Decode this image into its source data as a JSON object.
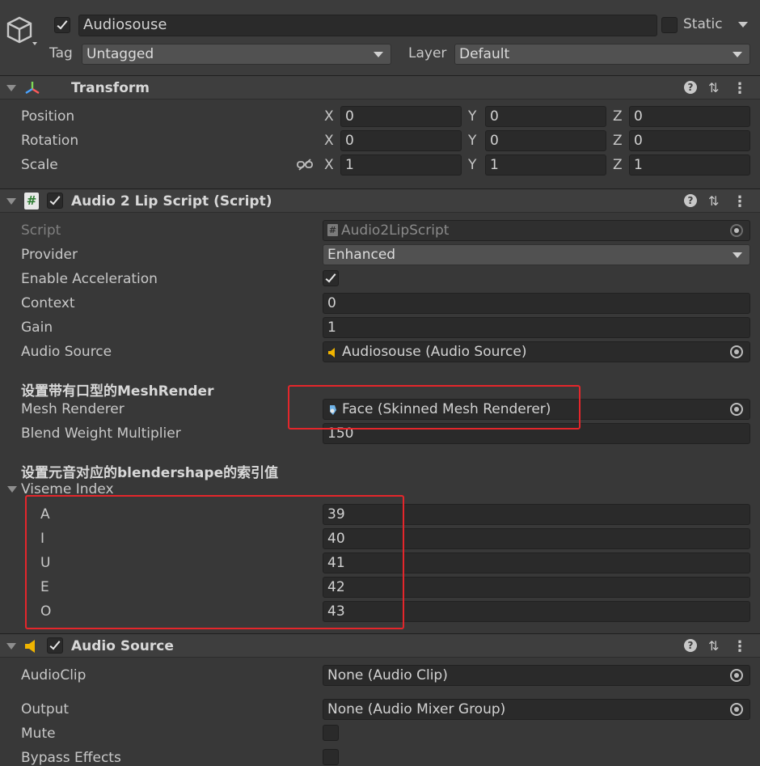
{
  "header": {
    "object_name": "Audiosouse",
    "static_label": "Static",
    "tag_label": "Tag",
    "tag_value": "Untagged",
    "layer_label": "Layer",
    "layer_value": "Default"
  },
  "transform": {
    "title": "Transform",
    "rows": [
      {
        "label": "Position",
        "x": "0",
        "y": "0",
        "z": "0"
      },
      {
        "label": "Rotation",
        "x": "0",
        "y": "0",
        "z": "0"
      },
      {
        "label": "Scale",
        "x": "1",
        "y": "1",
        "z": "1"
      }
    ],
    "axis_x": "X",
    "axis_y": "Y",
    "axis_z": "Z"
  },
  "audio2lip": {
    "title": "Audio 2 Lip Script (Script)",
    "script_label": "Script",
    "script_value": "Audio2LipScript",
    "provider_label": "Provider",
    "provider_value": "Enhanced",
    "accel_label": "Enable Acceleration",
    "context_label": "Context",
    "context_value": "0",
    "gain_label": "Gain",
    "gain_value": "1",
    "audio_source_label": "Audio Source",
    "audio_source_value": "Audiosouse (Audio Source)",
    "mesh_header": "设置带有口型的MeshRender",
    "mesh_renderer_label": "Mesh Renderer",
    "mesh_renderer_value": "Face (Skinned Mesh Renderer)",
    "blend_label": "Blend Weight Multiplier",
    "blend_value": "150",
    "vowel_header": "设置元音对应的blendershape的索引值",
    "viseme_label": "Viseme Index",
    "visemes": [
      {
        "label": "A",
        "value": "39"
      },
      {
        "label": "I",
        "value": "40"
      },
      {
        "label": "U",
        "value": "41"
      },
      {
        "label": "E",
        "value": "42"
      },
      {
        "label": "O",
        "value": "43"
      }
    ]
  },
  "audio_source": {
    "title": "Audio Source",
    "clip_label": "AudioClip",
    "clip_value": "None (Audio Clip)",
    "output_label": "Output",
    "output_value": "None (Audio Mixer Group)",
    "mute_label": "Mute",
    "bypass_label": "Bypass Effects"
  },
  "icons": {
    "help": "?",
    "settings": "⇅",
    "menu": "⋮",
    "hash": "#"
  },
  "colors": {
    "highlight": "#e4262b",
    "background": "#383838",
    "field": "#2a2a2a"
  }
}
